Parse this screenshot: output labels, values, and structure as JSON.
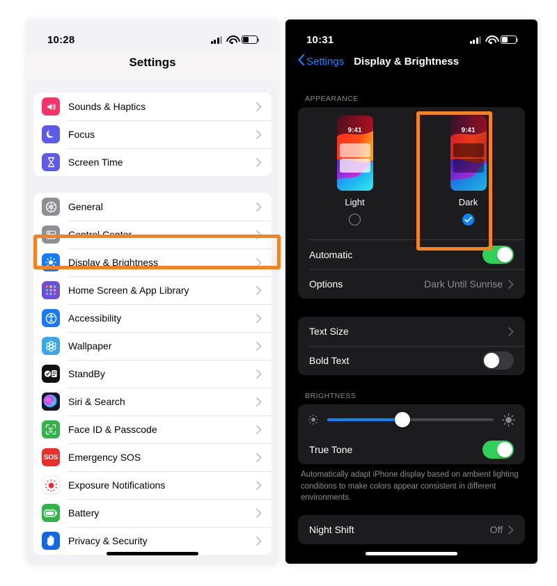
{
  "left_phone": {
    "status": {
      "time": "10:28",
      "signal_icon": "cellular-bars-icon",
      "wifi_icon": "wifi-icon",
      "battery_icon": "battery-icon"
    },
    "nav_title": "Settings",
    "groups": [
      {
        "items": [
          {
            "label": "Sounds & Haptics",
            "icon": "speaker-icon",
            "color": "#f4346a"
          },
          {
            "label": "Focus",
            "icon": "moon-icon",
            "color": "#5e5ce6"
          },
          {
            "label": "Screen Time",
            "icon": "hourglass-icon",
            "color": "#5e5ce6"
          }
        ]
      },
      {
        "items": [
          {
            "label": "General",
            "icon": "gear-icon",
            "color": "#8e8e93"
          },
          {
            "label": "Control Center",
            "icon": "sliders-icon",
            "color": "#8e8e93"
          },
          {
            "label": "Display & Brightness",
            "icon": "brightness-sun-icon",
            "color": "#157bfb"
          },
          {
            "label": "Home Screen & App Library",
            "icon": "app-grid-icon",
            "color": "#6a4fd8"
          },
          {
            "label": "Accessibility",
            "icon": "accessibility-icon",
            "color": "#157bfb"
          },
          {
            "label": "Wallpaper",
            "icon": "flower-icon",
            "color": "#39a7e8"
          },
          {
            "label": "StandBy",
            "icon": "standby-icon",
            "color": "#111113"
          },
          {
            "label": "Siri & Search",
            "icon": "siri-icon",
            "color": "#1b1b2b"
          },
          {
            "label": "Face ID & Passcode",
            "icon": "face-id-icon",
            "color": "#30b44a"
          },
          {
            "label": "Emergency SOS",
            "icon": "sos-icon",
            "color": "#e8302b"
          },
          {
            "label": "Exposure Notifications",
            "icon": "exposure-icon",
            "color": "#ffffff"
          },
          {
            "label": "Battery",
            "icon": "battery-green-icon",
            "color": "#30b44a"
          },
          {
            "label": "Privacy & Security",
            "icon": "hand-icon",
            "color": "#1168e3"
          }
        ]
      }
    ]
  },
  "right_phone": {
    "status": {
      "time": "10:31",
      "signal_icon": "cellular-bars-icon",
      "wifi_icon": "wifi-icon",
      "battery_icon": "battery-icon"
    },
    "back_label": "Settings",
    "nav_title": "Display & Brightness",
    "appearance": {
      "section_header": "APPEARANCE",
      "options": [
        {
          "label": "Light",
          "preview_time": "9:41",
          "selected": false
        },
        {
          "label": "Dark",
          "preview_time": "9:41",
          "selected": true
        }
      ],
      "automatic": {
        "label": "Automatic",
        "state": "on"
      },
      "options_row": {
        "label": "Options",
        "value": "Dark Until Sunrise"
      }
    },
    "text_group": {
      "text_size": {
        "label": "Text Size"
      },
      "bold_text": {
        "label": "Bold Text",
        "state": "off"
      }
    },
    "brightness": {
      "section_header": "BRIGHTNESS",
      "slider_percent": 45,
      "low_icon": "sun-small-icon",
      "high_icon": "sun-large-icon",
      "true_tone": {
        "label": "True Tone",
        "state": "on"
      },
      "footnote": "Automatically adapt iPhone display based on ambient lighting conditions to make colors appear consistent in different environments."
    },
    "night_shift": {
      "label": "Night Shift",
      "value": "Off"
    }
  },
  "annotations": {
    "highlight_color": "#f58220",
    "boxes": [
      {
        "name": "display-and-brightness-row-highlight"
      },
      {
        "name": "dark-appearance-highlight"
      }
    ]
  }
}
